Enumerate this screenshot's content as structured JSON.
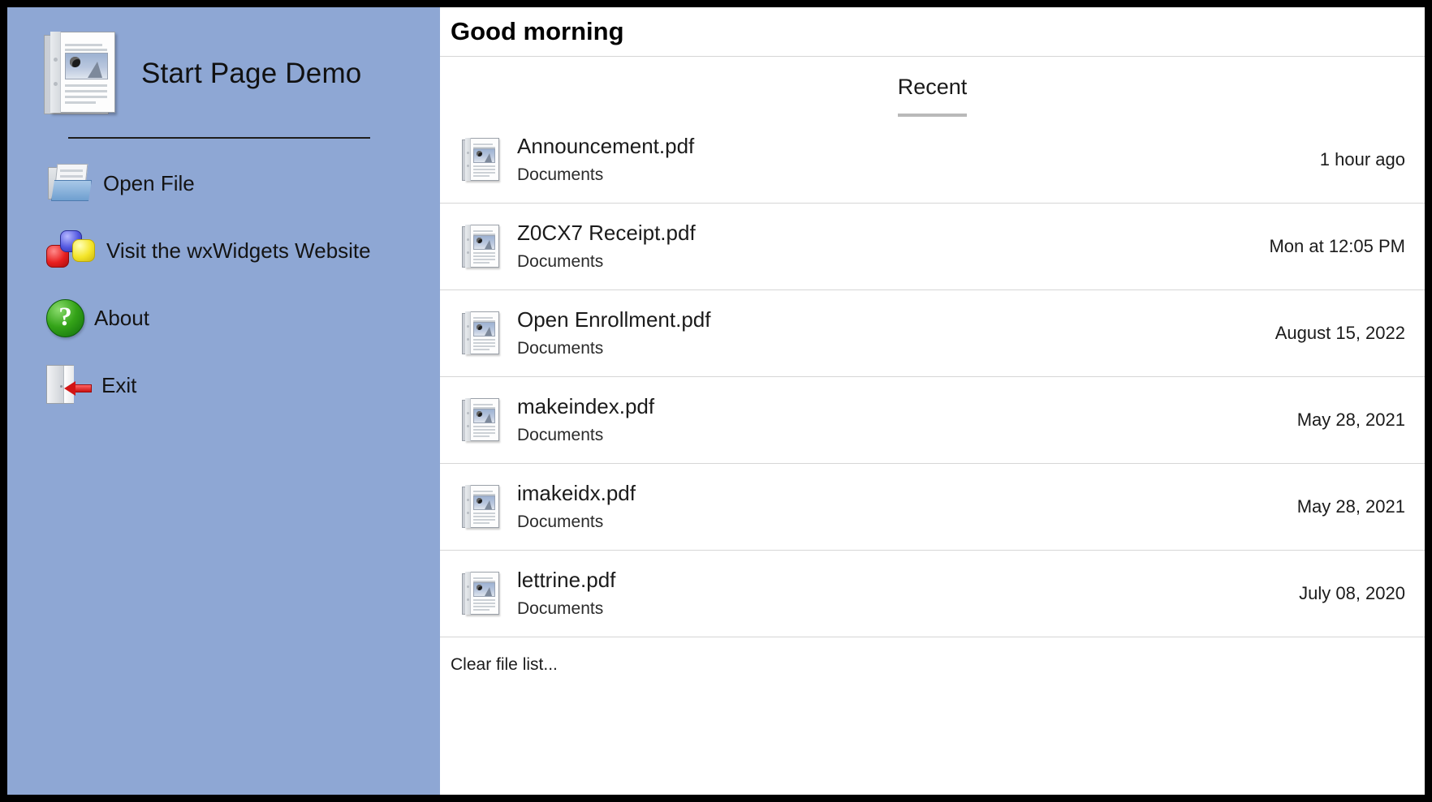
{
  "app": {
    "title": "Start Page Demo",
    "sidebar_bg": "#8ea7d4"
  },
  "sidebar": {
    "brand_label": "Start Page Demo",
    "items": [
      {
        "label": "Open File",
        "icon": "open-folder-icon"
      },
      {
        "label": "Visit the wxWidgets Website",
        "icon": "wxwidgets-blocks-icon"
      },
      {
        "label": "About",
        "icon": "question-mark-icon"
      },
      {
        "label": "Exit",
        "icon": "exit-door-icon"
      }
    ]
  },
  "main": {
    "greeting": "Good morning",
    "tabs": [
      {
        "label": "Recent",
        "active": true
      }
    ],
    "files": [
      {
        "name": "Announcement.pdf",
        "location": "Documents",
        "date": "1 hour ago"
      },
      {
        "name": "Z0CX7 Receipt.pdf",
        "location": "Documents",
        "date": "Mon at 12:05 PM"
      },
      {
        "name": "Open Enrollment.pdf",
        "location": "Documents",
        "date": "August 15, 2022"
      },
      {
        "name": "makeindex.pdf",
        "location": "Documents",
        "date": "May 28, 2021"
      },
      {
        "name": "imakeidx.pdf",
        "location": "Documents",
        "date": "May 28, 2021"
      },
      {
        "name": "lettrine.pdf",
        "location": "Documents",
        "date": "July 08, 2020"
      }
    ],
    "clear_link": "Clear file list..."
  }
}
